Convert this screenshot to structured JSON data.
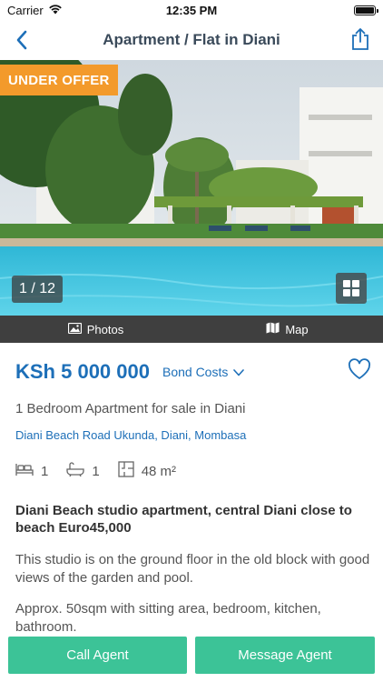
{
  "status_bar": {
    "carrier": "Carrier",
    "time": "12:35 PM"
  },
  "nav": {
    "title": "Apartment / Flat in Diani"
  },
  "hero": {
    "badge": "UNDER OFFER",
    "counter": "1 / 12"
  },
  "media_tabs": [
    {
      "label": "Photos"
    },
    {
      "label": "Map"
    }
  ],
  "listing": {
    "price": "KSh 5 000 000",
    "bond_costs": "Bond Costs",
    "subtitle": "1 Bedroom Apartment for sale in Diani",
    "address": "Diani Beach Road Ukunda, Diani, Mombasa",
    "features": {
      "bedrooms": "1",
      "bathrooms": "1",
      "size": "48 m²"
    },
    "headline": "Diani Beach studio apartment, central Diani close to beach Euro45,000",
    "description_1": "This studio is on the ground floor in the old block with good views of the garden and pool.",
    "description_2": "Approx. 50sqm with sitting area, bedroom, kitchen, bathroom."
  },
  "actions": {
    "call": "Call Agent",
    "message": "Message Agent"
  },
  "colors": {
    "accent": "#1d6fb8",
    "badge": "#f39a2b",
    "button": "#3cc397",
    "tab_bar": "#3f3f3f"
  },
  "icons": [
    "wifi-icon",
    "battery-icon",
    "back-chevron-icon",
    "share-icon",
    "grid-icon",
    "photo-icon",
    "map-icon",
    "chevron-down-icon",
    "heart-icon",
    "bed-icon",
    "bath-icon",
    "floor-plan-icon"
  ]
}
